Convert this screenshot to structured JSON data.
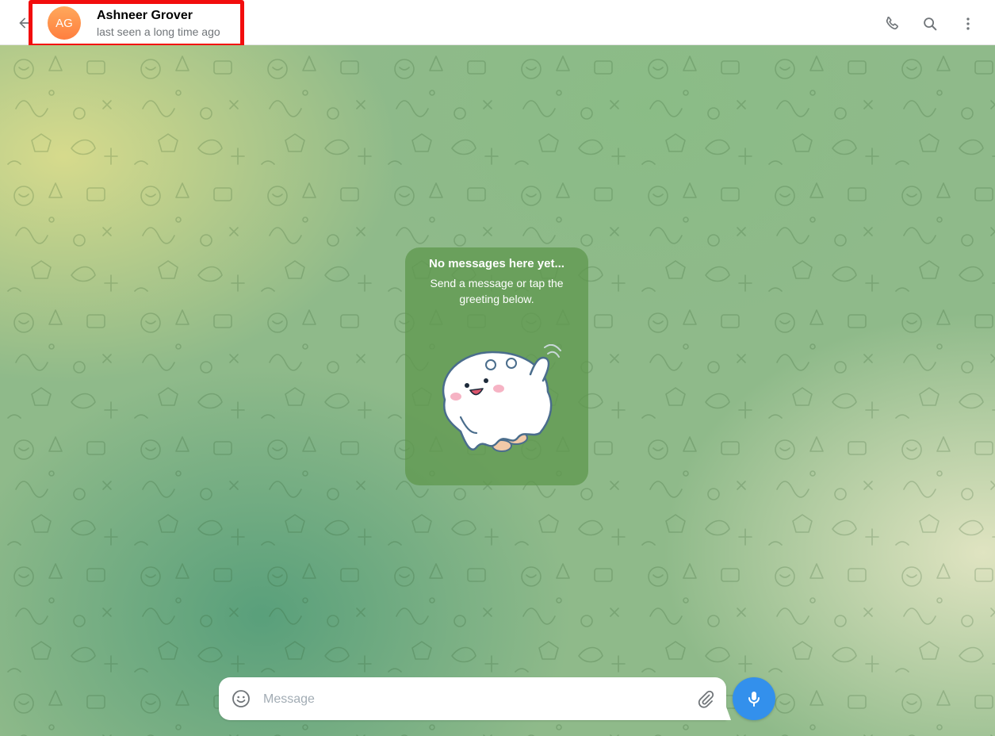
{
  "header": {
    "peer": {
      "initials": "AG",
      "name": "Ashneer Grover",
      "status": "last seen a long time ago"
    },
    "actions": [
      "phone-icon",
      "search-icon",
      "more-vertical-icon"
    ],
    "highlight_color": "#f20d0d"
  },
  "empty_state": {
    "title": "No messages here yet...",
    "subtitle": "Send a message or tap the greeting below."
  },
  "composer": {
    "placeholder": "Message",
    "value": ""
  },
  "colors": {
    "accent": "#3390ec",
    "avatar": "#ff8a48",
    "empty_card": "#609850"
  }
}
